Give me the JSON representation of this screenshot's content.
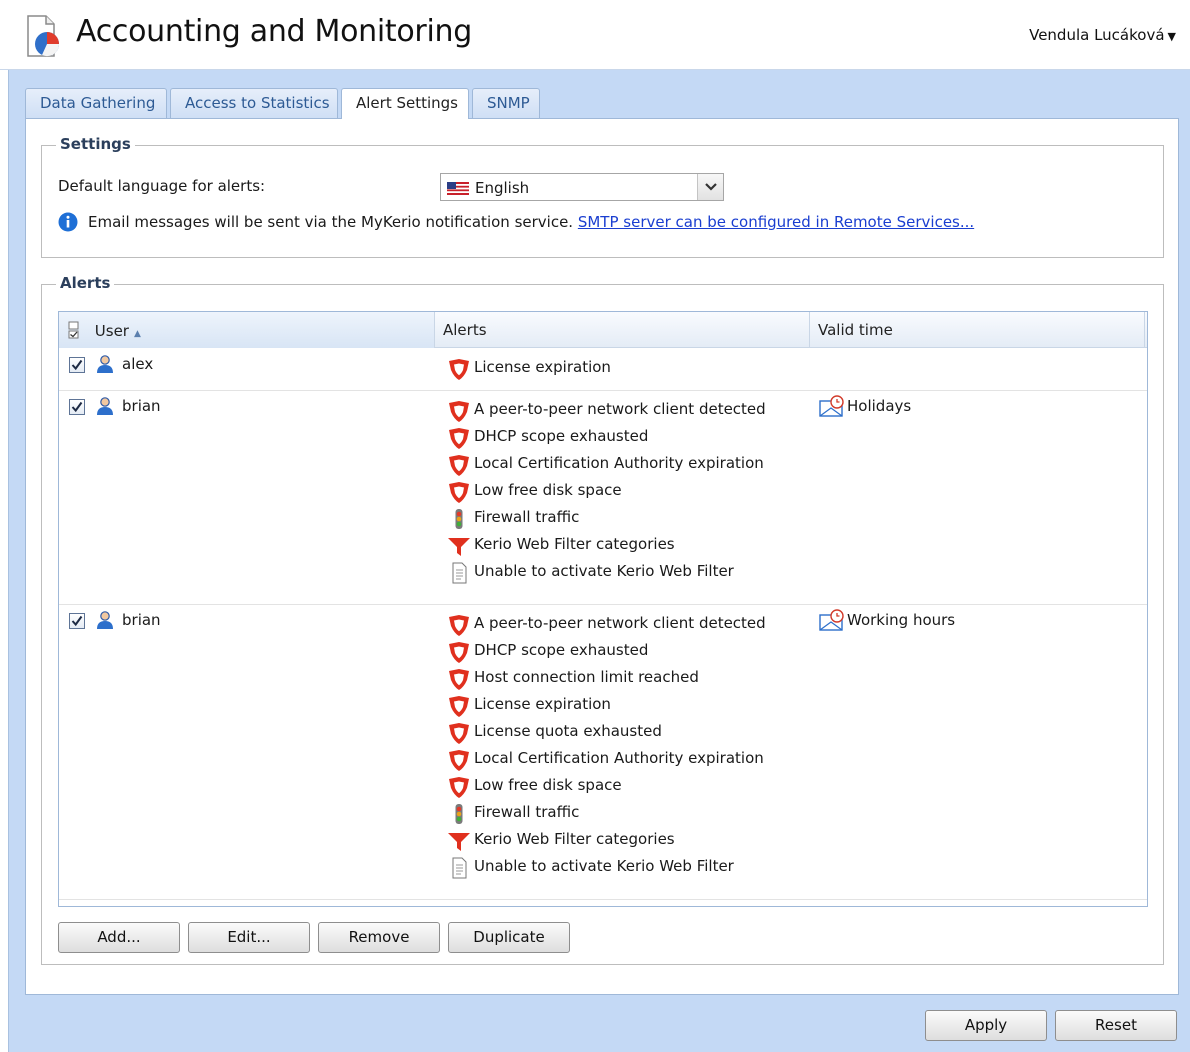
{
  "header": {
    "title": "Accounting and Monitoring",
    "user_name": "Vendula Lucáková"
  },
  "tabs": [
    {
      "label": "Data Gathering",
      "active": false
    },
    {
      "label": "Access to Statistics",
      "active": false
    },
    {
      "label": "Alert Settings",
      "active": true
    },
    {
      "label": "SNMP",
      "active": false
    }
  ],
  "settings": {
    "legend": "Settings",
    "language_label": "Default language for alerts:",
    "language_value": "English",
    "info_text": "Email messages will be sent via the MyKerio notification service.",
    "info_link": "SMTP server can be configured in Remote Services..."
  },
  "alerts": {
    "legend": "Alerts",
    "columns": {
      "user": "User",
      "alerts": "Alerts",
      "valid_time": "Valid time"
    },
    "rows": [
      {
        "checked": true,
        "user": "alex",
        "valid_time": "",
        "alerts": [
          {
            "icon": "shield-icon",
            "text": "License expiration"
          }
        ]
      },
      {
        "checked": true,
        "user": "brian",
        "valid_time": "Holidays",
        "alerts": [
          {
            "icon": "shield-icon",
            "text": "A peer-to-peer network client detected"
          },
          {
            "icon": "shield-icon",
            "text": "DHCP scope exhausted"
          },
          {
            "icon": "shield-icon",
            "text": "Local Certification Authority expiration"
          },
          {
            "icon": "shield-icon",
            "text": "Low free disk space"
          },
          {
            "icon": "traffic-light-icon",
            "text": "Firewall traffic"
          },
          {
            "icon": "filter-icon",
            "text": "Kerio Web Filter categories"
          },
          {
            "icon": "document-icon",
            "text": "Unable to activate Kerio Web Filter"
          }
        ]
      },
      {
        "checked": true,
        "user": "brian",
        "valid_time": "Working hours",
        "alerts": [
          {
            "icon": "shield-icon",
            "text": "A peer-to-peer network client detected"
          },
          {
            "icon": "shield-icon",
            "text": "DHCP scope exhausted"
          },
          {
            "icon": "shield-icon",
            "text": "Host connection limit reached"
          },
          {
            "icon": "shield-icon",
            "text": "License expiration"
          },
          {
            "icon": "shield-icon",
            "text": "License quota exhausted"
          },
          {
            "icon": "shield-icon",
            "text": "Local Certification Authority expiration"
          },
          {
            "icon": "shield-icon",
            "text": "Low free disk space"
          },
          {
            "icon": "traffic-light-icon",
            "text": "Firewall traffic"
          },
          {
            "icon": "filter-icon",
            "text": "Kerio Web Filter categories"
          },
          {
            "icon": "document-icon",
            "text": "Unable to activate Kerio Web Filter"
          }
        ]
      }
    ]
  },
  "buttons": {
    "add": "Add...",
    "edit": "Edit...",
    "remove": "Remove",
    "duplicate": "Duplicate",
    "apply": "Apply",
    "reset": "Reset"
  },
  "colors": {
    "workspace_bg": "#c4d9f5",
    "shield": "#e0301e",
    "link": "#1a3ed0"
  }
}
